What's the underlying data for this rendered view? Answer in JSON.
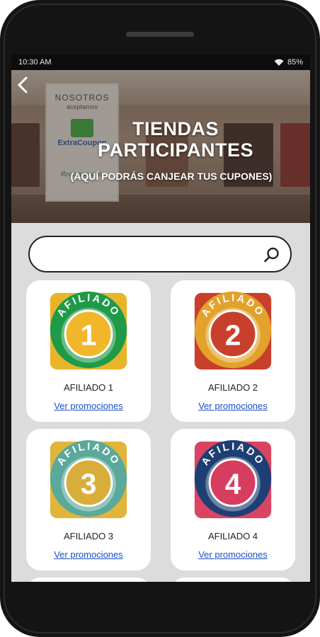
{
  "status_bar": {
    "time": "10:30 AM",
    "battery": "85%"
  },
  "hero": {
    "title_line1": "TIENDAS",
    "title_line2": "PARTICIPANTES",
    "subtitle": "(AQUÍ PODRÁS CANJEAR TUS CUPONES)",
    "sign": {
      "line1": "NOSOTROS",
      "line2": "aceptamos",
      "brand": "ExtraCoupon",
      "tag": "Recompensan"
    }
  },
  "search": {
    "placeholder": "",
    "value": ""
  },
  "badge_word": "AFILIADO",
  "affiliates": [
    {
      "number": "1",
      "name": "AFILIADO 1",
      "link": "Ver promociones",
      "colors": {
        "bg": "#e8b52a",
        "ring": "#1e9a48",
        "disc": "#f0b72b"
      }
    },
    {
      "number": "2",
      "name": "AFILIADO 2",
      "link": "Ver promociones",
      "colors": {
        "bg": "#c8402b",
        "ring": "#e3a22b",
        "disc": "#c8402b"
      }
    },
    {
      "number": "3",
      "name": "AFILIADO 3",
      "link": "Ver promociones",
      "colors": {
        "bg": "#e1b43a",
        "ring": "#5aa99a",
        "disc": "#d9ad39"
      }
    },
    {
      "number": "4",
      "name": "AFILIADO 4",
      "link": "Ver promociones",
      "colors": {
        "bg": "#d94462",
        "ring": "#1d3f73",
        "disc": "#d63d5e"
      }
    }
  ]
}
